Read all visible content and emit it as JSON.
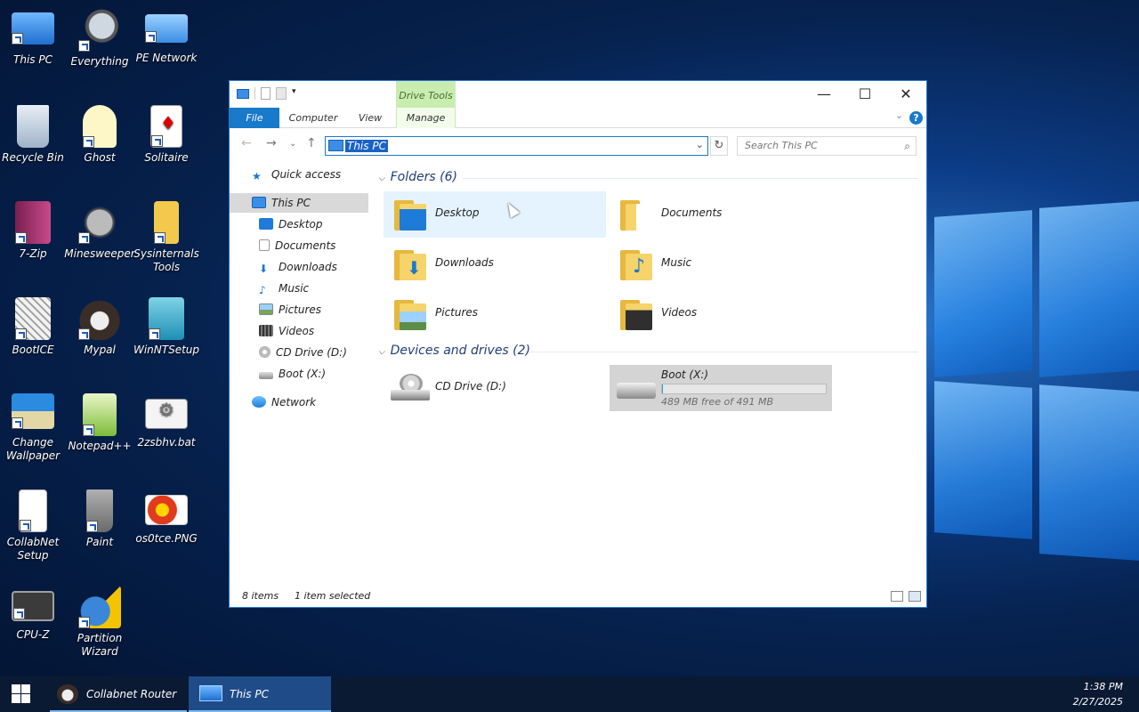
{
  "desktop": {
    "icons": [
      {
        "label": "This PC",
        "icon": "computer-icon"
      },
      {
        "label": "Everything",
        "icon": "magnifier-icon"
      },
      {
        "label": "PE Network",
        "icon": "network-icon"
      },
      {
        "label": "Recycle Bin",
        "icon": "recycle-bin-icon"
      },
      {
        "label": "Ghost",
        "icon": "ghost-icon"
      },
      {
        "label": "Solitaire",
        "icon": "cards-icon"
      },
      {
        "label": "7-Zip",
        "icon": "archive-icon"
      },
      {
        "label": "Minesweeper",
        "icon": "mine-icon"
      },
      {
        "label": "Sysinternals Tools",
        "icon": "folder-icon"
      },
      {
        "label": "BootICE",
        "icon": "bootice-icon"
      },
      {
        "label": "Mypal",
        "icon": "raccoon-icon"
      },
      {
        "label": "WinNTSetup",
        "icon": "setup-icon"
      },
      {
        "label": "Change Wallpaper",
        "icon": "wallpaper-icon"
      },
      {
        "label": "Notepad++",
        "icon": "notepad-icon"
      },
      {
        "label": "2zsbhv.bat",
        "icon": "gear-file-icon"
      },
      {
        "label": "CollabNet Setup",
        "icon": "blank-file-icon"
      },
      {
        "label": "Paint",
        "icon": "paint-icon"
      },
      {
        "label": "os0tce.PNG",
        "icon": "image-file-icon"
      },
      {
        "label": "CPU-Z",
        "icon": "chip-icon"
      },
      {
        "label": "Partition Wizard",
        "icon": "wizard-icon"
      }
    ]
  },
  "window": {
    "ribbon": {
      "context_tab": "Drive Tools",
      "tabs": [
        "File",
        "Computer",
        "View",
        "Manage"
      ]
    },
    "address": "This PC",
    "search_placeholder": "Search This PC",
    "nav": {
      "quick_access": "Quick access",
      "this_pc": "This PC",
      "children": [
        "Desktop",
        "Documents",
        "Downloads",
        "Music",
        "Pictures",
        "Videos",
        "CD Drive (D:)",
        "Boot (X:)"
      ],
      "network": "Network"
    },
    "folders_header": "Folders (6)",
    "folders": [
      "Desktop",
      "Documents",
      "Downloads",
      "Music",
      "Pictures",
      "Videos"
    ],
    "devices_header": "Devices and drives (2)",
    "drives": {
      "cd": "CD Drive (D:)",
      "boot": "Boot (X:)",
      "boot_free": "489 MB free of 491 MB",
      "boot_used_fraction": 0.004
    },
    "status": {
      "items": "8 items",
      "selected": "1 item selected"
    }
  },
  "taskbar": {
    "items": [
      "Collabnet Router ...",
      "This PC"
    ],
    "time": "1:38 PM",
    "date": "2/27/2025"
  },
  "colors": {
    "accent": "#1979ca",
    "drive_tools": "#c9ecb0",
    "folder": "#f6d36b"
  }
}
